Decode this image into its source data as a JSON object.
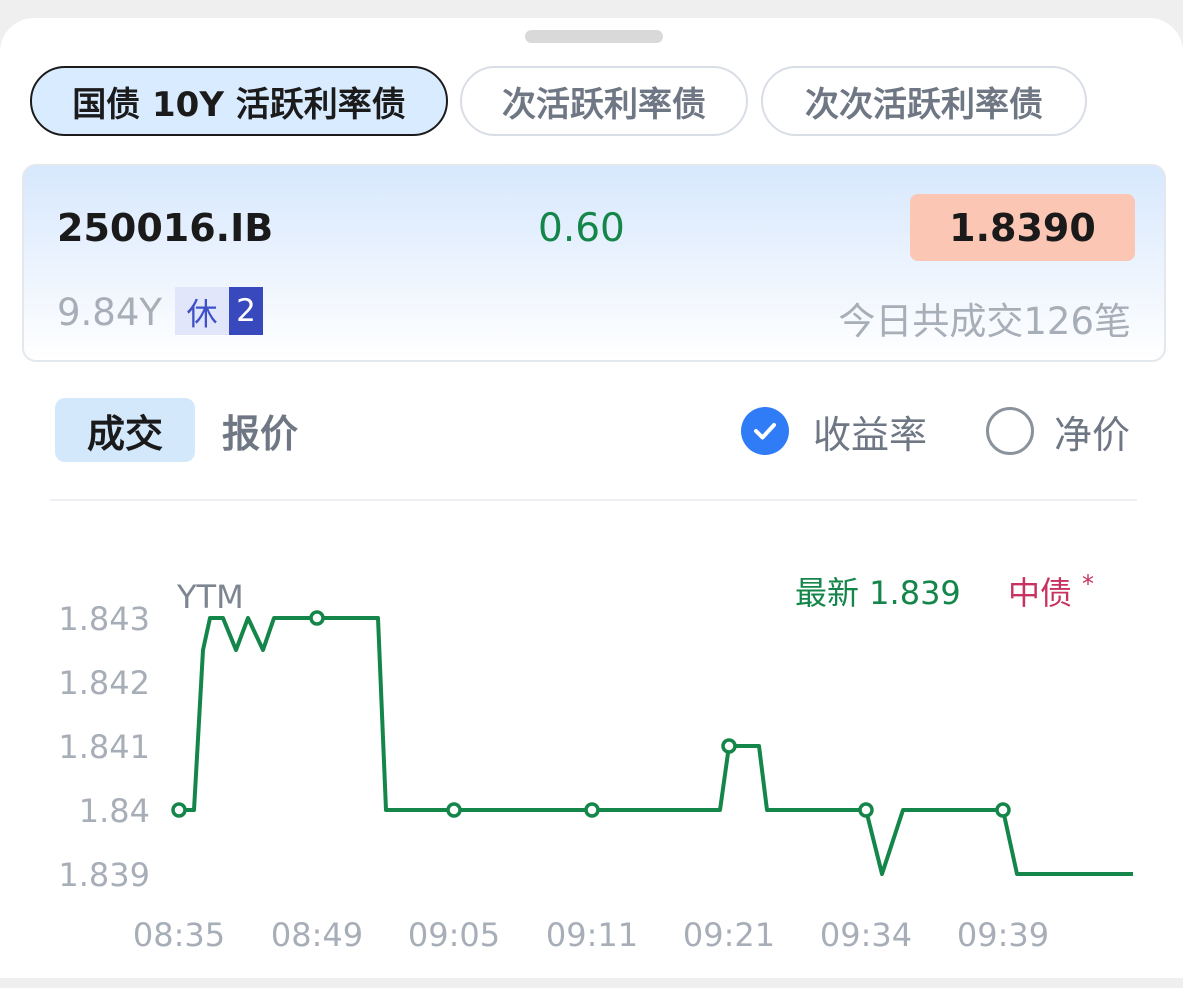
{
  "tabs": [
    {
      "label": "国债 10Y 活跃利率债",
      "active": true
    },
    {
      "label": "次活跃利率债",
      "active": false
    },
    {
      "label": "次次活跃利率债",
      "active": false
    }
  ],
  "bond": {
    "code": "250016.IB",
    "change": "0.60",
    "price": "1.8390",
    "tenor": "9.84Y",
    "rest_label": "休",
    "rest_count": "2",
    "trade_summary": "今日共成交126笔"
  },
  "view_tabs": {
    "trade": "成交",
    "quote": "报价"
  },
  "mode": {
    "yield_label": "收益率",
    "yield_checked": true,
    "net_label": "净价",
    "net_checked": false
  },
  "legend": {
    "latest": "最新 1.839",
    "source": "中债",
    "source_mark": "*"
  },
  "colors": {
    "line": "#14864a",
    "axis_text": "#a7aeb8",
    "change": "#14864a",
    "price_bg": "#fcc6b4",
    "accent": "#2f7cf6"
  },
  "chart_data": {
    "type": "line",
    "ylabel": "YTM",
    "ylim": [
      1.839,
      1.843
    ],
    "yticks": [
      "1.843",
      "1.842",
      "1.841",
      "1.84",
      "1.839"
    ],
    "yticks_values": [
      1.843,
      1.842,
      1.841,
      1.84,
      1.839
    ],
    "xticks": [
      "08:35",
      "08:49",
      "09:05",
      "09:11",
      "09:21",
      "09:34",
      "09:39"
    ],
    "grid": false,
    "series": [
      {
        "values": [
          1.84,
          1.84,
          1.8425,
          1.843,
          1.843,
          1.8425,
          1.843,
          1.8425,
          1.843,
          1.843,
          1.843,
          1.84,
          1.84,
          1.84,
          1.84,
          1.841,
          1.841,
          1.84,
          1.84,
          1.839,
          1.84,
          1.84,
          1.839,
          1.839
        ],
        "markers": [
          1.84,
          1.843,
          1.84,
          1.84,
          1.841,
          1.84,
          1.84
        ]
      }
    ]
  }
}
